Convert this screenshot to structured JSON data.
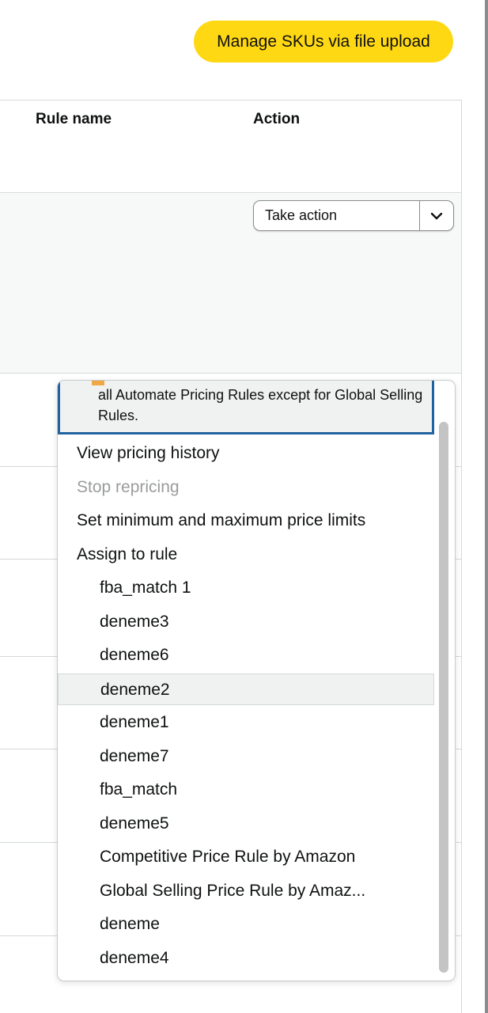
{
  "toolbar": {
    "upload_button_label": "Manage SKUs via file upload"
  },
  "table": {
    "headers": {
      "rule_name": "Rule name",
      "action": "Action"
    }
  },
  "take_action": {
    "selected_label": "Take action",
    "chevron_icon": "chevron-down-icon"
  },
  "dropdown": {
    "notice_text": "all Automate Pricing Rules except for Global Selling Rules.",
    "items": [
      {
        "label": "View pricing history",
        "level": "top",
        "disabled": false,
        "highlighted": false
      },
      {
        "label": "Stop repricing",
        "level": "top",
        "disabled": true,
        "highlighted": false
      },
      {
        "label": "Set minimum and maximum price limits",
        "level": "top",
        "disabled": false,
        "highlighted": false
      },
      {
        "label": "Assign to rule",
        "level": "top",
        "disabled": false,
        "highlighted": false
      },
      {
        "label": "fba_match 1",
        "level": "sub",
        "disabled": false,
        "highlighted": false
      },
      {
        "label": "deneme3",
        "level": "sub",
        "disabled": false,
        "highlighted": false
      },
      {
        "label": "deneme6",
        "level": "sub",
        "disabled": false,
        "highlighted": false
      },
      {
        "label": "deneme2",
        "level": "sub",
        "disabled": false,
        "highlighted": true
      },
      {
        "label": "deneme1",
        "level": "sub",
        "disabled": false,
        "highlighted": false
      },
      {
        "label": "deneme7",
        "level": "sub",
        "disabled": false,
        "highlighted": false
      },
      {
        "label": "fba_match",
        "level": "sub",
        "disabled": false,
        "highlighted": false
      },
      {
        "label": "deneme5",
        "level": "sub",
        "disabled": false,
        "highlighted": false
      },
      {
        "label": "Competitive Price Rule by Amazon",
        "level": "sub",
        "disabled": false,
        "highlighted": false
      },
      {
        "label": "Global Selling Price Rule by Amaz...",
        "level": "sub",
        "disabled": false,
        "highlighted": false
      },
      {
        "label": "deneme",
        "level": "sub",
        "disabled": false,
        "highlighted": false
      },
      {
        "label": "deneme4",
        "level": "sub",
        "disabled": false,
        "highlighted": false
      }
    ]
  },
  "colors": {
    "upload_button_bg": "#ffd814",
    "notice_border": "#2162a1",
    "notice_accent": "#f0a847",
    "row_shade": "#f7f8f8",
    "border": "#d5d9d9",
    "disabled_text": "#9a9c9c"
  }
}
